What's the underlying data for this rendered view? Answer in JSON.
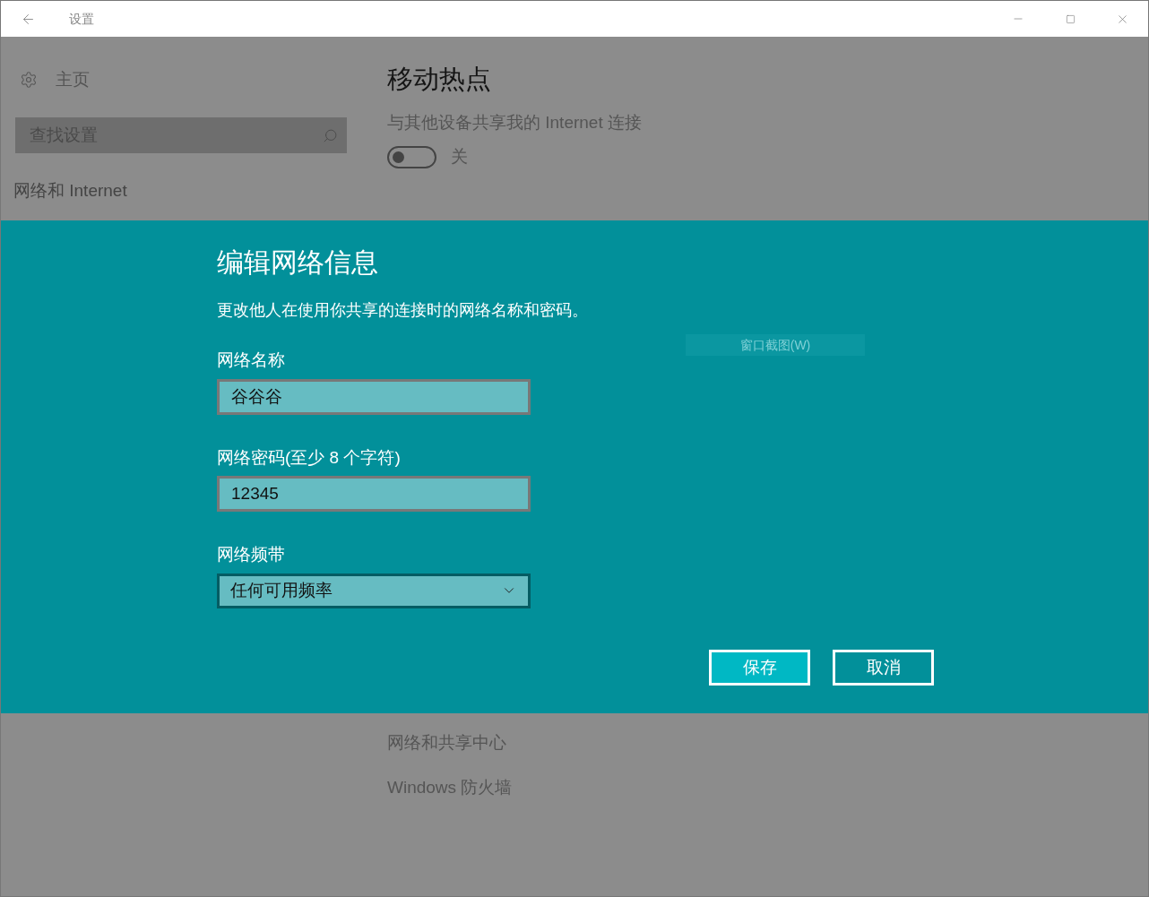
{
  "window": {
    "title": "设置"
  },
  "sidebar": {
    "home": "主页",
    "search": {
      "placeholder": "查找设置"
    },
    "section": "网络和 Internet"
  },
  "page": {
    "title": "移动热点",
    "share_label": "与其他设备共享我的 Internet 连接",
    "hotspot": {
      "on": false,
      "state_label": "关"
    },
    "links": [
      "网络和共享中心",
      "Windows 防火墙"
    ]
  },
  "dialog": {
    "title": "编辑网络信息",
    "description": "更改他人在使用你共享的连接时的网络名称和密码。",
    "fields": [
      {
        "kind": "text",
        "label": "网络名称",
        "value": "谷谷谷"
      },
      {
        "kind": "text",
        "label": "网络密码(至少 8 个字符)",
        "value": "12345"
      },
      {
        "kind": "dropdown",
        "label": "网络频带",
        "value": "任何可用频率"
      }
    ],
    "buttons": [
      {
        "label": "保存",
        "primary": true
      },
      {
        "label": "取消",
        "primary": false
      }
    ]
  },
  "tooltip": "窗口截图(W)"
}
